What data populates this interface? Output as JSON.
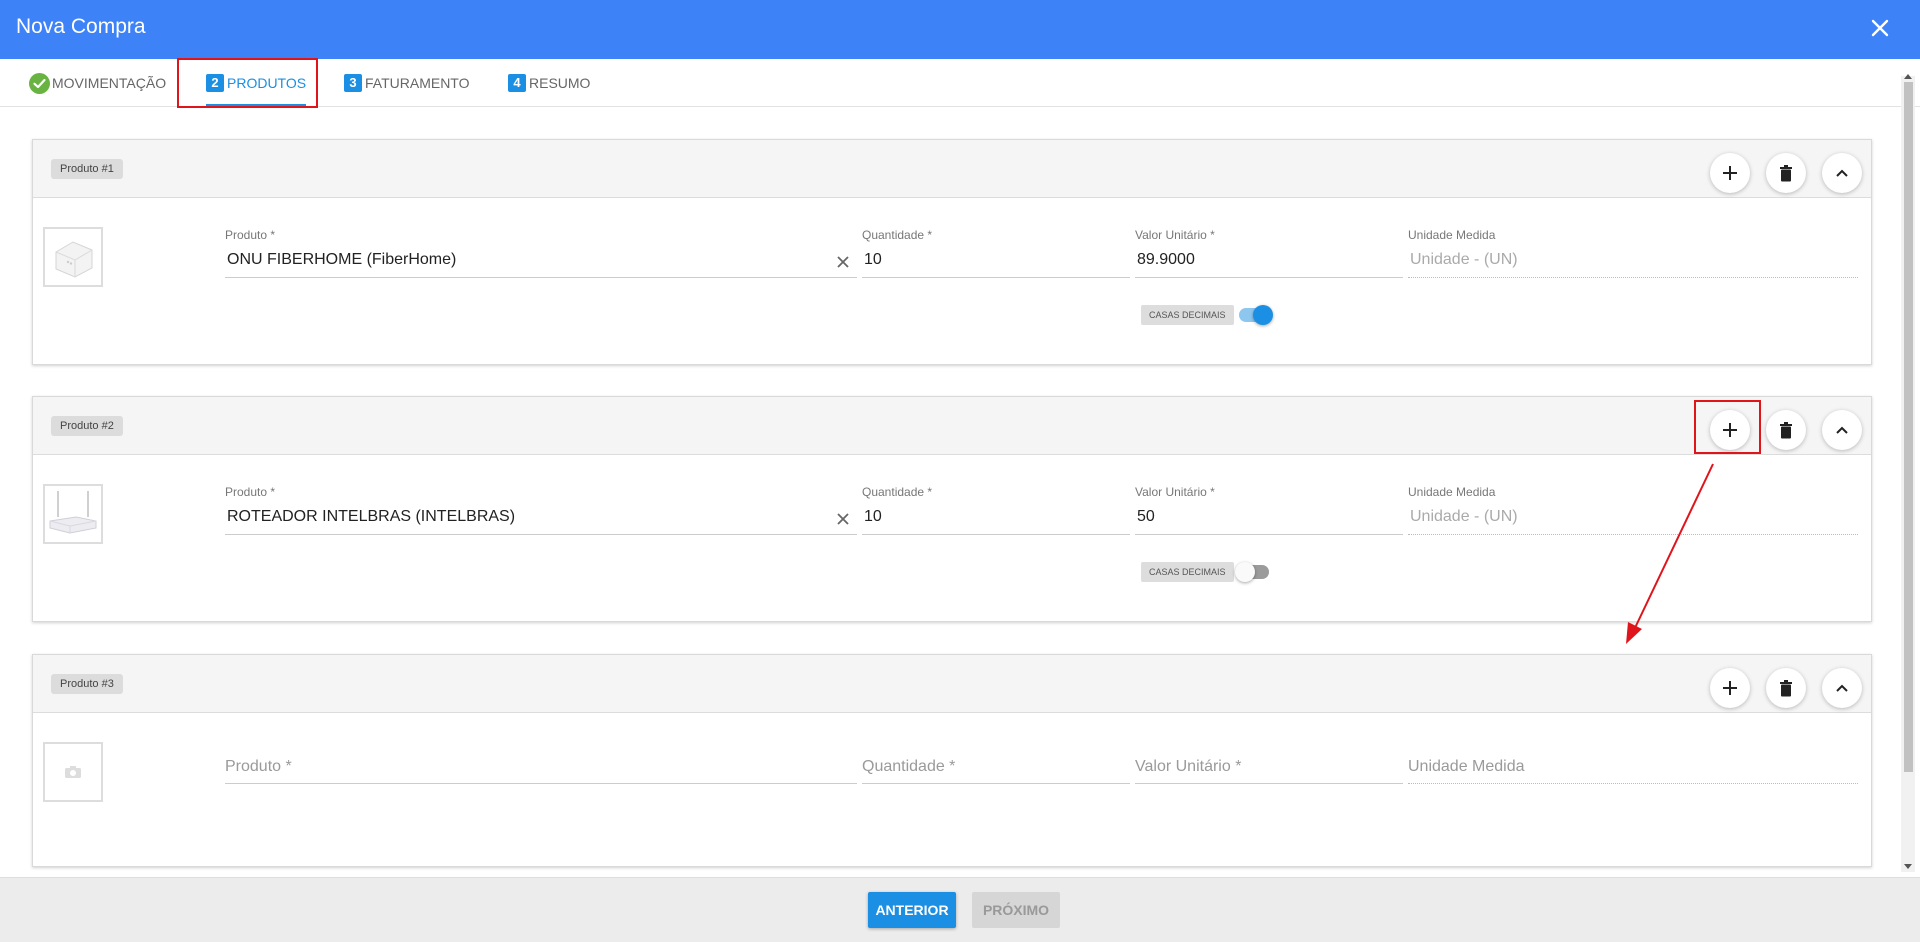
{
  "window": {
    "title": "Nova Compra"
  },
  "tabs": [
    {
      "num": "",
      "label": "MOVIMENTAÇÃO",
      "state": "done"
    },
    {
      "num": "2",
      "label": "PRODUTOS",
      "state": "active"
    },
    {
      "num": "3",
      "label": "FATURAMENTO",
      "state": "pending"
    },
    {
      "num": "4",
      "label": "RESUMO",
      "state": "pending"
    }
  ],
  "labels": {
    "produto": "Produto *",
    "quantidade": "Quantidade *",
    "valor": "Valor Unitário *",
    "unidade": "Unidade Medida",
    "casas_decimais": "CASAS DECIMAIS"
  },
  "products": [
    {
      "badge": "Produto #1",
      "produto": "ONU FIBERHOME  (FiberHome)",
      "quantidade": "10",
      "valor": "89.9000",
      "unidade": "Unidade - (UN)",
      "casas_decimais_on": true
    },
    {
      "badge": "Produto #2",
      "produto": "ROTEADOR INTELBRAS (INTELBRAS)",
      "quantidade": "10",
      "valor": "50",
      "unidade": "Unidade - (UN)",
      "casas_decimais_on": false
    },
    {
      "badge": "Produto #3",
      "produto": "",
      "quantidade": "",
      "valor": "",
      "unidade": ""
    }
  ],
  "footer": {
    "prev_label": "ANTERIOR",
    "next_label": "PRÓXIMO"
  },
  "colors": {
    "header": "#3d82f7",
    "accent": "#1a8fe3",
    "annotation": "#e0141b",
    "success": "#68b342"
  }
}
